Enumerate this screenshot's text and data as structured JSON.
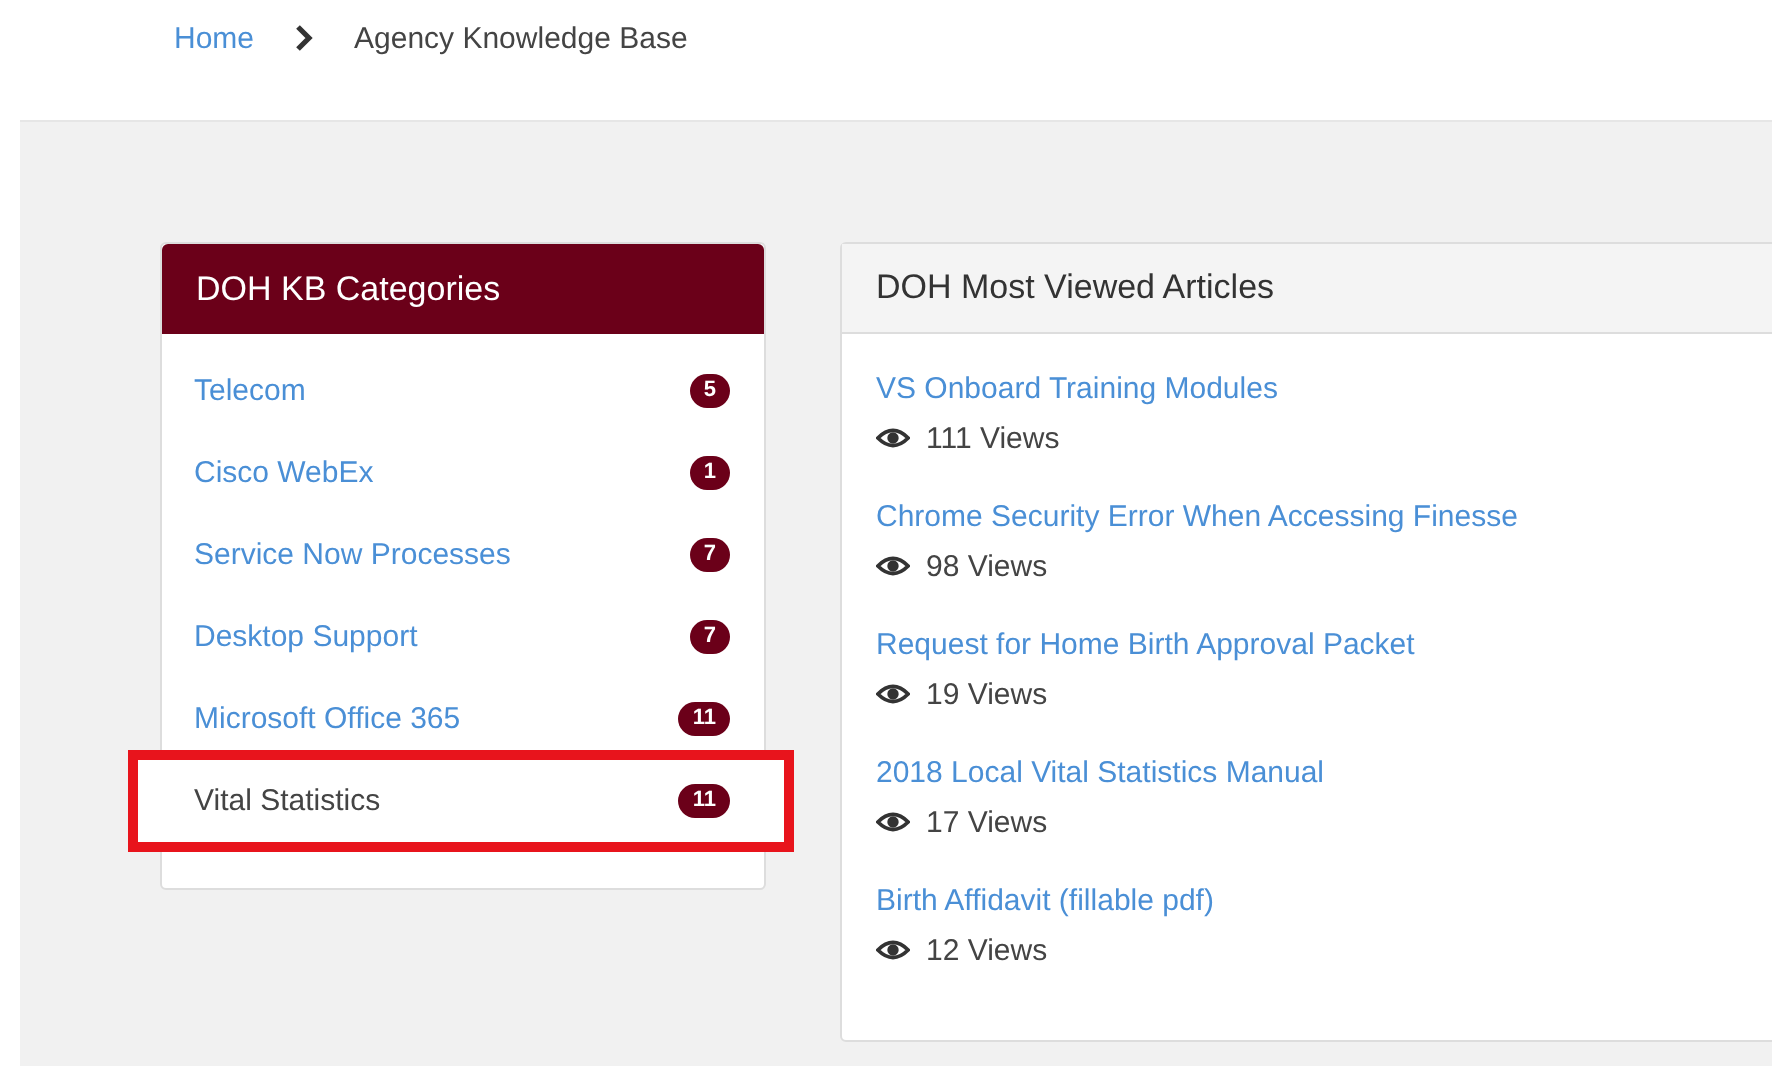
{
  "breadcrumb": [
    {
      "label": "Home",
      "link": true
    },
    {
      "label": "Agency Knowledge Base",
      "link": false
    }
  ],
  "categories_panel": {
    "title": "DOH KB Categories",
    "items": [
      {
        "label": "Telecom",
        "count": "5",
        "highlighted": false
      },
      {
        "label": "Cisco WebEx",
        "count": "1",
        "highlighted": false
      },
      {
        "label": "Service Now Processes",
        "count": "7",
        "highlighted": false
      },
      {
        "label": "Desktop Support",
        "count": "7",
        "highlighted": false
      },
      {
        "label": "Microsoft Office 365",
        "count": "11",
        "highlighted": false
      },
      {
        "label": "Vital Statistics",
        "count": "11",
        "highlighted": true
      }
    ]
  },
  "articles_panel": {
    "title": "DOH Most Viewed Articles",
    "articles": [
      {
        "title": "VS Onboard Training Modules",
        "views": "111 Views"
      },
      {
        "title": "Chrome Security Error When Accessing Finesse",
        "views": "98 Views"
      },
      {
        "title": "Request for Home Birth Approval Packet",
        "views": "19 Views"
      },
      {
        "title": "2018 Local Vital Statistics Manual",
        "views": "17 Views"
      },
      {
        "title": "Birth Affidavit (fillable pdf)",
        "views": "12 Views"
      }
    ]
  }
}
